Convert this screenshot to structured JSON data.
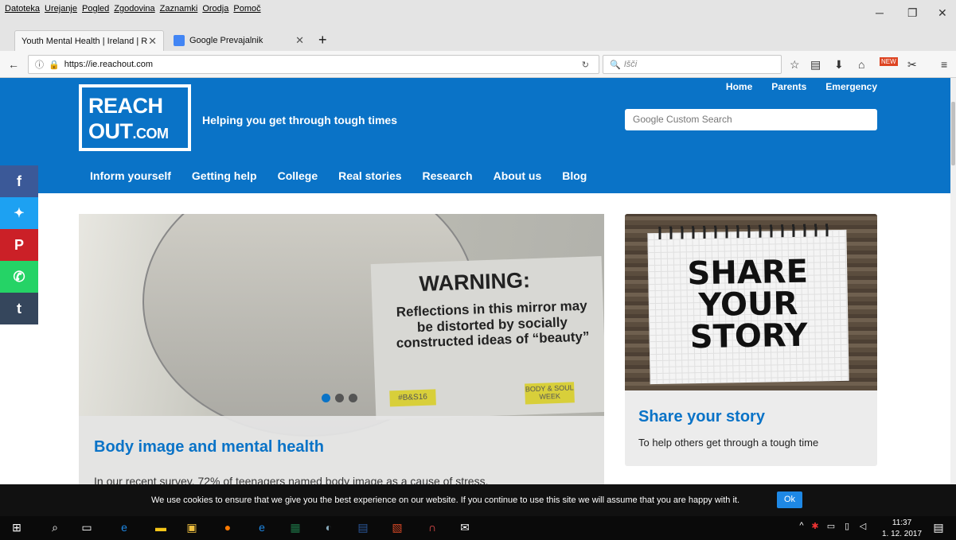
{
  "menubar": {
    "items": [
      "Datoteka",
      "Urejanje",
      "Pogled",
      "Zgodovina",
      "Zaznamki",
      "Orodja",
      "Pomoč"
    ]
  },
  "tabs": [
    {
      "label": "Youth Mental Health | Ireland | R"
    },
    {
      "label": "Google Prevajalnik"
    }
  ],
  "urlbar": {
    "url": "https://ie.reachout.com",
    "search_placeholder": "Išči"
  },
  "toolbar": {
    "new_badge": "NEW"
  },
  "site": {
    "logo_line1": "REACH",
    "logo_line2": "OUT",
    "logo_suffix": ".COM",
    "tagline": "Helping you get through tough times",
    "top_links": [
      "Home",
      "Parents",
      "Emergency"
    ],
    "search_placeholder": "Google Custom Search",
    "nav": [
      "Inform yourself",
      "Getting help",
      "College",
      "Real stories",
      "Research",
      "About us",
      "Blog"
    ]
  },
  "social": [
    {
      "name": "facebook",
      "glyph": "f",
      "color": "#3b5998"
    },
    {
      "name": "twitter",
      "glyph": "🐦",
      "color": "#1da1f2"
    },
    {
      "name": "pinterest",
      "glyph": "P",
      "color": "#cb2027"
    },
    {
      "name": "whatsapp",
      "glyph": "✆",
      "color": "#25d366"
    },
    {
      "name": "tumblr",
      "glyph": "t",
      "color": "#35465c"
    }
  ],
  "hero": {
    "warning_title": "WARNING:",
    "warning_text": "Reflections in this mirror may be distorted by socially constructed ideas of “beauty”",
    "tag_left": "#B&S16",
    "tag_right": "BODY & SOUL WEEK",
    "caption_title": "Body image and mental health",
    "caption_text": "In our recent survey, 72% of teenagers named body image as a cause of stress."
  },
  "share_card": {
    "image_text": "SHARE YOUR STORY",
    "title": "Share your story",
    "subtitle": "To help others get through a tough time"
  },
  "cookie": {
    "message": "We use cookies to ensure that we give you the best experience on our website. If you continue to use this site we will assume that you are happy with it.",
    "ok_label": "Ok"
  },
  "taskbar": {
    "time": "11:37",
    "date": "1. 12. 2017"
  }
}
